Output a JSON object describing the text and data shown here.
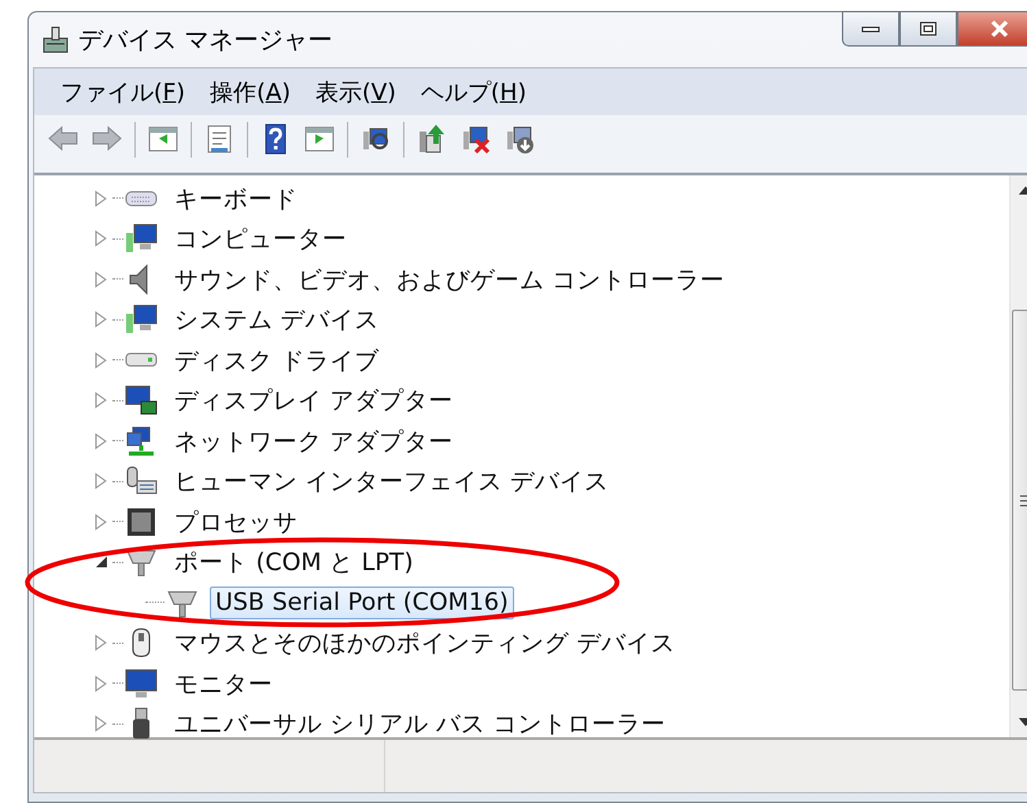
{
  "window": {
    "title": "デバイス マネージャー"
  },
  "menu": [
    {
      "before": "ファイル(",
      "key": "F",
      "after": ")"
    },
    {
      "before": "操作(",
      "key": "A",
      "after": ")"
    },
    {
      "before": "表示(",
      "key": "V",
      "after": ")"
    },
    {
      "before": "ヘルプ(",
      "key": "H",
      "after": ")"
    }
  ],
  "tree": [
    {
      "label": "キーボード",
      "expanded": false
    },
    {
      "label": "コンピューター",
      "expanded": false
    },
    {
      "label": "サウンド、ビデオ、およびゲーム コントローラー",
      "expanded": false
    },
    {
      "label": "システム デバイス",
      "expanded": false
    },
    {
      "label": "ディスク ドライブ",
      "expanded": false
    },
    {
      "label": "ディスプレイ アダプター",
      "expanded": false
    },
    {
      "label": "ネットワーク アダプター",
      "expanded": false
    },
    {
      "label": "ヒューマン インターフェイス デバイス",
      "expanded": false
    },
    {
      "label": "プロセッサ",
      "expanded": false
    },
    {
      "label": "ポート (COM と LPT)",
      "expanded": true,
      "children": [
        {
          "label": "USB Serial Port (COM16)",
          "selected": true
        }
      ]
    },
    {
      "label": "マウスとそのほかのポインティング デバイス",
      "expanded": false
    },
    {
      "label": "モニター",
      "expanded": false
    },
    {
      "label": "ユニバーサル シリアル バス コントローラー",
      "expanded": false
    }
  ]
}
